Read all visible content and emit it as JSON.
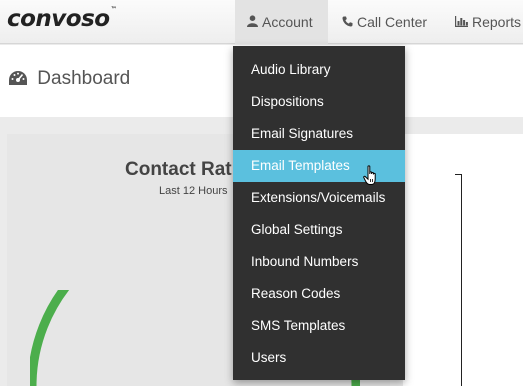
{
  "header": {
    "logo_text": "CONVOSO",
    "logo_mark": "™",
    "nav": [
      {
        "label": "Account",
        "icon": "user-icon"
      },
      {
        "label": "Call Center",
        "icon": "phone-icon"
      },
      {
        "label": "Reports",
        "icon": "bar-chart-icon"
      }
    ]
  },
  "page": {
    "title": "Dashboard",
    "title_icon": "dashboard-gauge-icon"
  },
  "chart": {
    "title": "Contact Rat",
    "subtitle": "Last 12 Hours",
    "ring_color": "#4cae4c"
  },
  "account_menu": {
    "items": [
      {
        "label": "Audio Library"
      },
      {
        "label": "Dispositions"
      },
      {
        "label": "Email Signatures"
      },
      {
        "label": "Email Templates",
        "highlighted": true
      },
      {
        "label": "Extensions/Voicemails"
      },
      {
        "label": "Global Settings"
      },
      {
        "label": "Inbound Numbers"
      },
      {
        "label": "Reason Codes"
      },
      {
        "label": "SMS Templates"
      },
      {
        "label": "Users"
      }
    ],
    "highlight_color": "#5bc0de",
    "background_color": "#303030"
  }
}
